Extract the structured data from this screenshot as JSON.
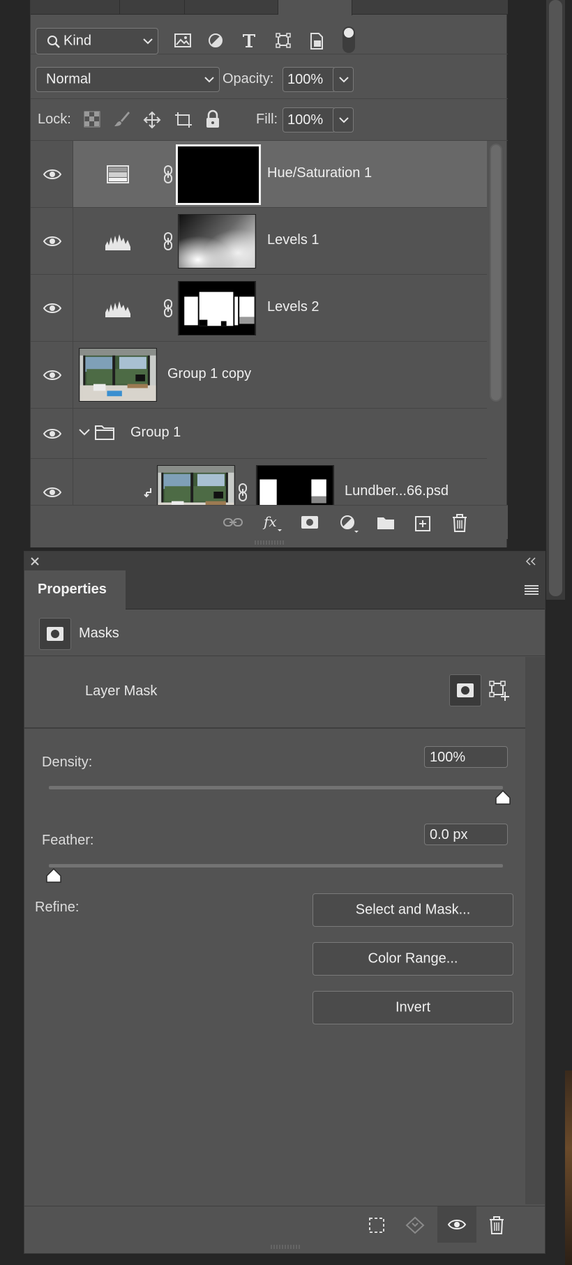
{
  "layers_panel": {
    "filter": {
      "label": "Kind"
    },
    "blend_mode": "Normal",
    "opacity_label": "Opacity:",
    "opacity_value": "100%",
    "lock_label": "Lock:",
    "fill_label": "Fill:",
    "fill_value": "100%",
    "layers": [
      {
        "name": "Hue/Saturation 1",
        "type": "adjustment-hue-saturation",
        "selected": true
      },
      {
        "name": "Levels 1",
        "type": "adjustment-levels"
      },
      {
        "name": "Levels 2",
        "type": "adjustment-levels"
      },
      {
        "name": "Group 1 copy",
        "type": "smart-object"
      },
      {
        "name": "Group 1",
        "type": "group",
        "expanded": true
      },
      {
        "name": "Lundber...66.psd",
        "type": "clipped-layer-with-mask"
      }
    ]
  },
  "properties_panel": {
    "title": "Properties",
    "section": "Masks",
    "mask_type": "Layer Mask",
    "density_label": "Density:",
    "density_value": "100%",
    "density_level": 100,
    "feather_label": "Feather:",
    "feather_value": "0.0 px",
    "feather_level": 0,
    "refine_label": "Refine:",
    "buttons": {
      "select_and_mask": "Select and Mask...",
      "color_range": "Color Range...",
      "invert": "Invert"
    }
  },
  "colors": {
    "panel_bg": "#535353",
    "selected_row": "#686868",
    "header_bg": "#3e3e3e",
    "app_bg": "#262626"
  }
}
